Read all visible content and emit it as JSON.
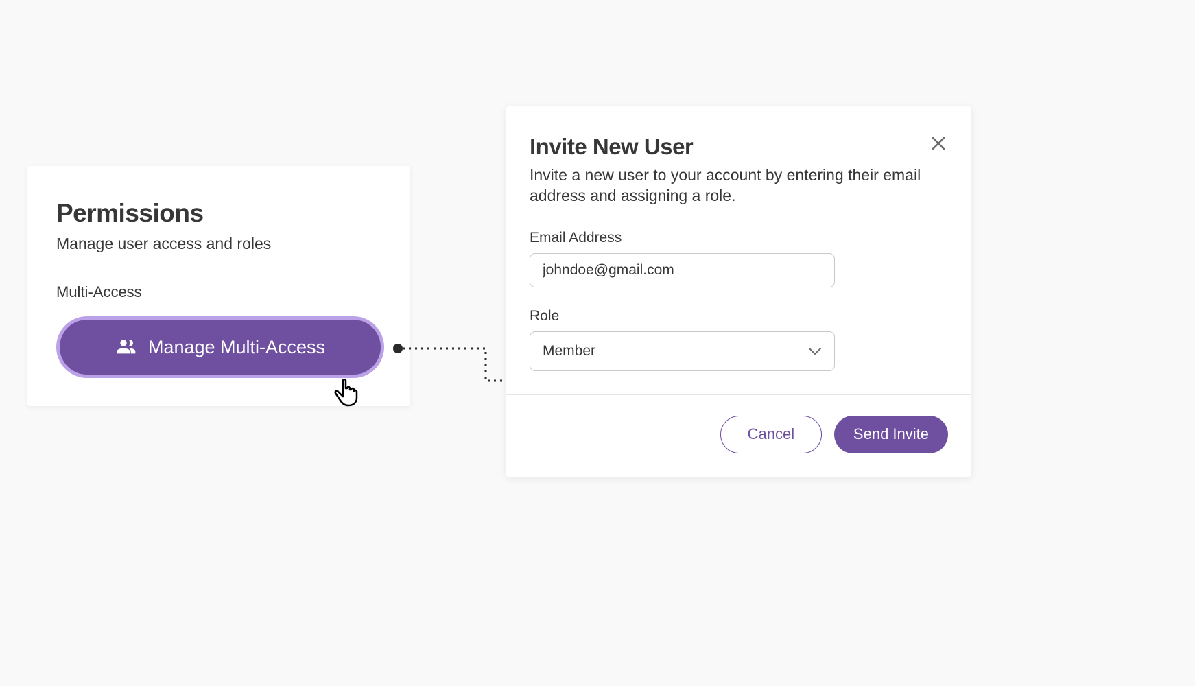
{
  "permissions": {
    "title": "Permissions",
    "subtitle": "Manage user access and roles",
    "section_label": "Multi-Access",
    "manage_button_label": "Manage Multi-Access"
  },
  "modal": {
    "title": "Invite New User",
    "description": "Invite a new user to your account by entering their email address and assigning a role.",
    "email_label": "Email Address",
    "email_value": "johndoe@gmail.com",
    "role_label": "Role",
    "role_value": "Member",
    "cancel_label": "Cancel",
    "send_label": "Send Invite"
  },
  "colors": {
    "purple": "#6F4FA0",
    "purple_light": "#BBA2E8",
    "text": "#373737"
  }
}
